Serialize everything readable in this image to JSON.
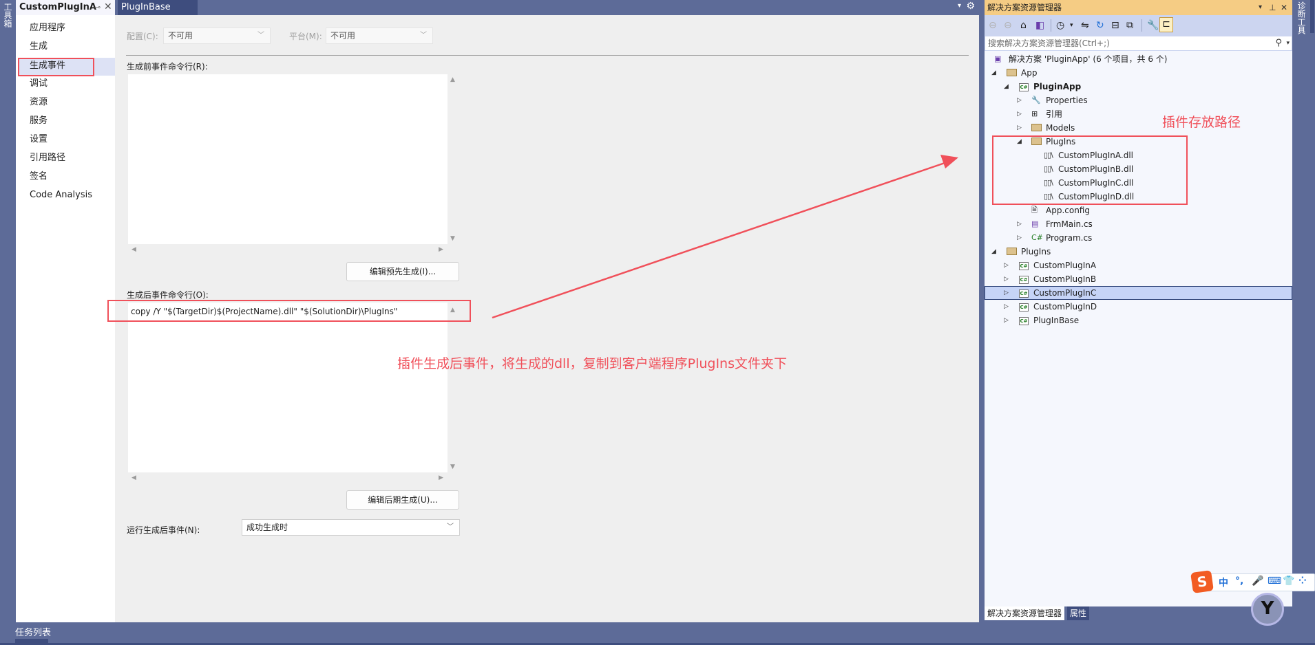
{
  "left_strip": {
    "label": "工具箱"
  },
  "right_strip": {
    "label": "诊断工具"
  },
  "tabs": [
    {
      "label": "CustomPlugInA",
      "active": true
    },
    {
      "label": "PlugInBase",
      "active": false
    }
  ],
  "tab_icons": {
    "pin": "⊸",
    "close": "✕",
    "dropdown": "▾",
    "settings": "⚙"
  },
  "sidebar": {
    "items": [
      {
        "label": "应用程序"
      },
      {
        "label": "生成"
      },
      {
        "label": "生成事件",
        "selected": true
      },
      {
        "label": "调试"
      },
      {
        "label": "资源"
      },
      {
        "label": "服务"
      },
      {
        "label": "设置"
      },
      {
        "label": "引用路径"
      },
      {
        "label": "签名"
      },
      {
        "label": "Code Analysis"
      }
    ]
  },
  "config": {
    "configuration_label": "配置(C):",
    "configuration_value": "不可用",
    "platform_label": "平台(M):",
    "platform_value": "不可用"
  },
  "prebuild": {
    "label": "生成前事件命令行(R):",
    "value": "",
    "edit_button": "编辑预先生成(I)..."
  },
  "postbuild": {
    "label": "生成后事件命令行(O):",
    "value": "copy /Y \"$(TargetDir)$(ProjectName).dll\" \"$(SolutionDir)\\PlugIns\"",
    "edit_button": "编辑后期生成(U)..."
  },
  "run_postbuild": {
    "label": "运行生成后事件(N):",
    "value": "成功生成时"
  },
  "annotations": {
    "postbuild_note": "插件生成后事件，将生成的dll，复制到客户端程序PlugIns文件夹下",
    "plugin_path_note": "插件存放路径",
    "color": "#f0505a"
  },
  "solution_explorer": {
    "title": "解决方案资源管理器",
    "search_placeholder": "搜索解决方案资源管理器(Ctrl+;)",
    "toolbar": [
      {
        "icon": "back-icon",
        "glyph": "⊖",
        "enabled": false
      },
      {
        "icon": "forward-icon",
        "glyph": "⊖",
        "enabled": false
      },
      {
        "icon": "home-icon",
        "glyph": "⌂",
        "enabled": true
      },
      {
        "icon": "switch-views-icon",
        "glyph": "◧",
        "enabled": true
      },
      {
        "icon": "pending-changes-filter-icon",
        "glyph": "◷",
        "enabled": true
      },
      {
        "icon": "dropdown-icon",
        "glyph": "▾",
        "enabled": true
      },
      {
        "icon": "sync-icon",
        "glyph": "⇋",
        "enabled": true
      },
      {
        "icon": "refresh-icon",
        "glyph": "↻",
        "enabled": true
      },
      {
        "icon": "collapse-all-icon",
        "glyph": "⊟",
        "enabled": true
      },
      {
        "icon": "show-all-files-icon",
        "glyph": "⧉",
        "enabled": true
      },
      {
        "icon": "properties-icon",
        "glyph": "🔧",
        "enabled": true
      },
      {
        "icon": "preview-selected-icon",
        "glyph": "⊏",
        "enabled": true
      }
    ],
    "tree": [
      {
        "label": "解决方案 'PluginApp' (6 个项目，共 6 个)",
        "level": 0,
        "icon": "solution",
        "expander": ""
      },
      {
        "label": "App",
        "level": 0,
        "icon": "folder",
        "expander": "open"
      },
      {
        "label": "PluginApp",
        "level": 1,
        "icon": "csproj",
        "expander": "open",
        "bold": true
      },
      {
        "label": "Properties",
        "level": 2,
        "icon": "wrench",
        "expander": "closed"
      },
      {
        "label": "引用",
        "level": 2,
        "icon": "references",
        "expander": "closed"
      },
      {
        "label": "Models",
        "level": 2,
        "icon": "folder",
        "expander": "closed"
      },
      {
        "label": "PlugIns",
        "level": 2,
        "icon": "folder",
        "expander": "open"
      },
      {
        "label": "CustomPlugInA.dll",
        "level": 3,
        "icon": "dll",
        "expander": ""
      },
      {
        "label": "CustomPlugInB.dll",
        "level": 3,
        "icon": "dll",
        "expander": ""
      },
      {
        "label": "CustomPlugInC.dll",
        "level": 3,
        "icon": "dll",
        "expander": ""
      },
      {
        "label": "CustomPlugInD.dll",
        "level": 3,
        "icon": "dll",
        "expander": ""
      },
      {
        "label": "App.config",
        "level": 2,
        "icon": "config",
        "expander": ""
      },
      {
        "label": "FrmMain.cs",
        "level": 2,
        "icon": "form",
        "expander": "closed"
      },
      {
        "label": "Program.cs",
        "level": 2,
        "icon": "csfile",
        "expander": "closed"
      },
      {
        "label": "PlugIns",
        "level": 0,
        "icon": "folder",
        "expander": "open"
      },
      {
        "label": "CustomPlugInA",
        "level": 1,
        "icon": "csproj",
        "expander": "closed"
      },
      {
        "label": "CustomPlugInB",
        "level": 1,
        "icon": "csproj",
        "expander": "closed"
      },
      {
        "label": "CustomPlugInC",
        "level": 1,
        "icon": "csproj",
        "expander": "closed",
        "selected": true
      },
      {
        "label": "CustomPlugInD",
        "level": 1,
        "icon": "csproj",
        "expander": "closed"
      },
      {
        "label": "PlugInBase",
        "level": 1,
        "icon": "csproj",
        "expander": "closed"
      }
    ],
    "bottom_tabs": [
      {
        "label": "解决方案资源管理器",
        "active": true
      },
      {
        "label": "属性",
        "active": false
      }
    ]
  },
  "bottom_bar": {
    "task_list": "任务列表"
  },
  "ime": {
    "logo": "S",
    "items": [
      "中",
      "°,",
      "🎤",
      "⌨",
      "👕",
      "⁘"
    ]
  },
  "assistant": {
    "glyph": "Y"
  }
}
